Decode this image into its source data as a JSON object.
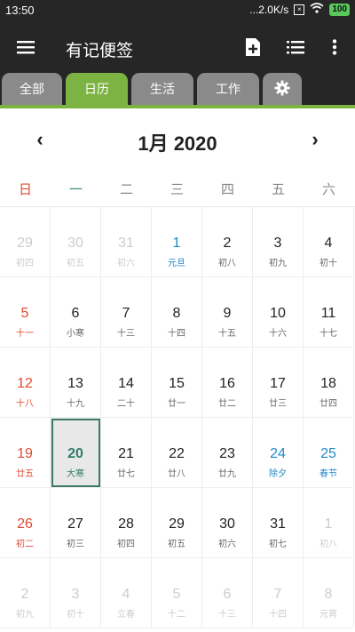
{
  "status": {
    "time": "13:50",
    "net": "...2.0K/s",
    "battery": "100"
  },
  "appbar": {
    "title": "有记便签"
  },
  "tabs": [
    "全部",
    "日历",
    "生活",
    "工作"
  ],
  "month": {
    "label": "1月 2020"
  },
  "weekdays": [
    "日",
    "一",
    "二",
    "三",
    "四",
    "五",
    "六"
  ],
  "weeks": [
    [
      {
        "d": "29",
        "l": "初四",
        "t": "out"
      },
      {
        "d": "30",
        "l": "初五",
        "t": "out"
      },
      {
        "d": "31",
        "l": "初六",
        "t": "out"
      },
      {
        "d": "1",
        "l": "元旦",
        "t": "fest"
      },
      {
        "d": "2",
        "l": "初八",
        "t": "norm"
      },
      {
        "d": "3",
        "l": "初九",
        "t": "norm"
      },
      {
        "d": "4",
        "l": "初十",
        "t": "norm"
      }
    ],
    [
      {
        "d": "5",
        "l": "十一",
        "t": "sun"
      },
      {
        "d": "6",
        "l": "小寒",
        "t": "norm"
      },
      {
        "d": "7",
        "l": "十三",
        "t": "norm"
      },
      {
        "d": "8",
        "l": "十四",
        "t": "norm"
      },
      {
        "d": "9",
        "l": "十五",
        "t": "norm"
      },
      {
        "d": "10",
        "l": "十六",
        "t": "norm"
      },
      {
        "d": "11",
        "l": "十七",
        "t": "norm"
      }
    ],
    [
      {
        "d": "12",
        "l": "十八",
        "t": "sun"
      },
      {
        "d": "13",
        "l": "十九",
        "t": "norm"
      },
      {
        "d": "14",
        "l": "二十",
        "t": "norm"
      },
      {
        "d": "15",
        "l": "廿一",
        "t": "norm"
      },
      {
        "d": "16",
        "l": "廿二",
        "t": "norm"
      },
      {
        "d": "17",
        "l": "廿三",
        "t": "norm"
      },
      {
        "d": "18",
        "l": "廿四",
        "t": "norm"
      }
    ],
    [
      {
        "d": "19",
        "l": "廿五",
        "t": "sun"
      },
      {
        "d": "20",
        "l": "大寒",
        "t": "selected"
      },
      {
        "d": "21",
        "l": "廿七",
        "t": "norm"
      },
      {
        "d": "22",
        "l": "廿八",
        "t": "norm"
      },
      {
        "d": "23",
        "l": "廿九",
        "t": "norm"
      },
      {
        "d": "24",
        "l": "除夕",
        "t": "fest"
      },
      {
        "d": "25",
        "l": "春节",
        "t": "fest"
      }
    ],
    [
      {
        "d": "26",
        "l": "初二",
        "t": "sun"
      },
      {
        "d": "27",
        "l": "初三",
        "t": "norm"
      },
      {
        "d": "28",
        "l": "初四",
        "t": "norm"
      },
      {
        "d": "29",
        "l": "初五",
        "t": "norm"
      },
      {
        "d": "30",
        "l": "初六",
        "t": "norm"
      },
      {
        "d": "31",
        "l": "初七",
        "t": "norm"
      },
      {
        "d": "1",
        "l": "初八",
        "t": "out"
      }
    ],
    [
      {
        "d": "2",
        "l": "初九",
        "t": "out"
      },
      {
        "d": "3",
        "l": "初十",
        "t": "out"
      },
      {
        "d": "4",
        "l": "立春",
        "t": "out"
      },
      {
        "d": "5",
        "l": "十二",
        "t": "out"
      },
      {
        "d": "6",
        "l": "十三",
        "t": "out"
      },
      {
        "d": "7",
        "l": "十四",
        "t": "out"
      },
      {
        "d": "8",
        "l": "元宵",
        "t": "out"
      }
    ]
  ],
  "colors": {
    "accent": "#7cb342",
    "sun": "#e04a2f",
    "fest": "#1e88c8",
    "out": "#cccccc",
    "norm": "#222222",
    "selectedText": "#2e7d6a",
    "weekdaySun": "#e04a2f",
    "weekdayMon": "#3d8a7a"
  }
}
